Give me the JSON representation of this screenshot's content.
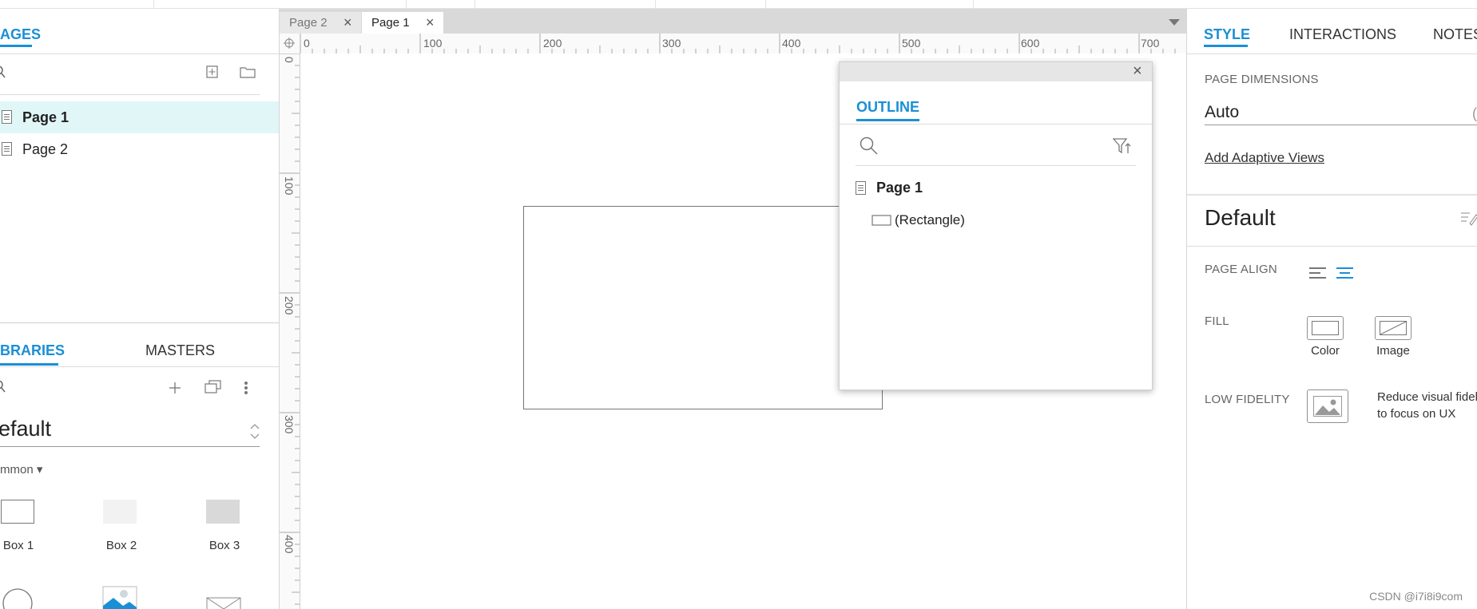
{
  "left": {
    "pages_tab": "AGES",
    "pages": [
      {
        "label": "Page 1",
        "selected": true
      },
      {
        "label": "Page 2",
        "selected": false
      }
    ],
    "lib_tabs": {
      "libraries": "BRARIES",
      "masters": "MASTERS"
    },
    "library_select": "efault",
    "category": "mmon ▾",
    "widgets": [
      {
        "label": "Box 1"
      },
      {
        "label": "Box 2"
      },
      {
        "label": "Box 3"
      }
    ]
  },
  "doc_tabs": [
    {
      "label": "Page 2",
      "active": false
    },
    {
      "label": "Page 1",
      "active": true
    }
  ],
  "ruler": {
    "h": [
      "0",
      "100",
      "200",
      "300",
      "400",
      "500",
      "600",
      "700"
    ],
    "v": [
      "0",
      "100",
      "200",
      "300",
      "400"
    ]
  },
  "outline": {
    "tab": "OUTLINE",
    "page": "Page 1",
    "item": "(Rectangle)"
  },
  "right": {
    "tabs": [
      "STYLE",
      "INTERACTIONS",
      "NOTES"
    ],
    "page_dimensions_label": "PAGE DIMENSIONS",
    "page_dimensions_value": "Auto",
    "adaptive_link": "Add Adaptive Views",
    "style_name": "Default",
    "page_align_label": "PAGE ALIGN",
    "fill_label": "FILL",
    "fill_color": "Color",
    "fill_image": "Image",
    "low_fidelity_label": "LOW FIDELITY",
    "low_fidelity_desc1": "Reduce visual fidel",
    "low_fidelity_desc2": "to focus on UX"
  },
  "watermark": "CSDN @i7i8i9com",
  "colors": {
    "accent": "#1a8fd6",
    "selected_row": "#e1f6f7"
  }
}
